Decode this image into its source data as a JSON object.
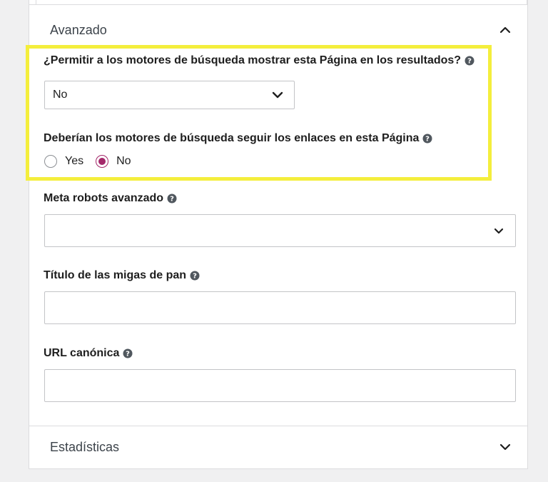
{
  "sections": {
    "avanzado": {
      "title": "Avanzado",
      "expanded": true,
      "chevron_icon": "chevron-up-icon"
    },
    "estadisticas": {
      "title": "Estadísticas",
      "expanded": false,
      "chevron_icon": "chevron-down-icon"
    }
  },
  "fields": {
    "allow_search_results": {
      "label": "¿Permitir a los motores de búsqueda mostrar esta Página en los resultados?",
      "selected": "No",
      "help_icon": "question-circle-icon"
    },
    "follow_links": {
      "label": "Deberían los motores de búsqueda seguir los enlaces en esta Página",
      "help_icon": "question-circle-icon",
      "options": [
        "Yes",
        "No"
      ],
      "selected": "No"
    },
    "meta_robots": {
      "label": "Meta robots avanzado",
      "selected": "",
      "help_icon": "question-circle-icon"
    },
    "breadcrumb_title": {
      "label": "Título de las migas de pan",
      "value": "",
      "help_icon": "question-circle-icon"
    },
    "canonical_url": {
      "label": "URL canónica",
      "value": "",
      "help_icon": "question-circle-icon"
    }
  },
  "colors": {
    "highlight": "#f4ee3c",
    "radio_accent": "#a4286a",
    "border": "#c3c4c7",
    "divider": "#dcdcde"
  }
}
